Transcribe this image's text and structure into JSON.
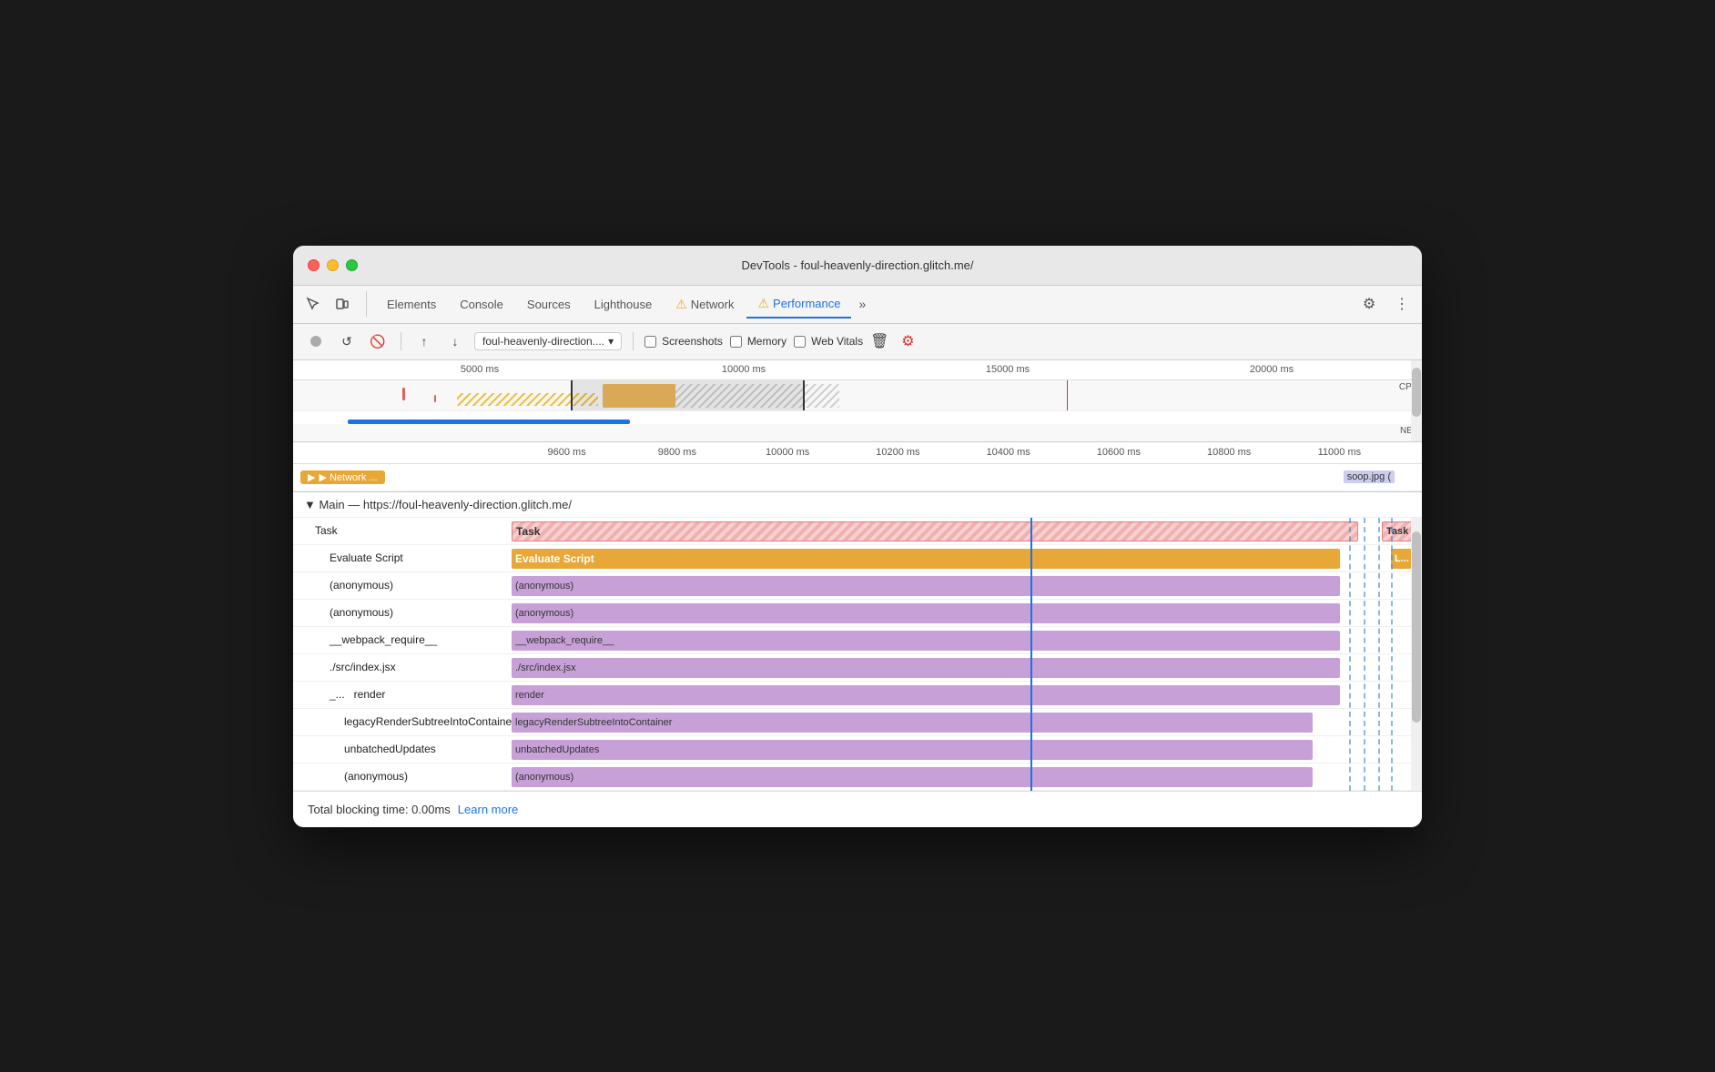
{
  "window": {
    "title": "DevTools - foul-heavenly-direction.glitch.me/"
  },
  "tabs": {
    "items": [
      {
        "label": "Elements",
        "active": false
      },
      {
        "label": "Console",
        "active": false
      },
      {
        "label": "Sources",
        "active": false
      },
      {
        "label": "Lighthouse",
        "active": false
      },
      {
        "label": "Network",
        "active": false,
        "warning": true
      },
      {
        "label": "Performance",
        "active": true,
        "warning": true
      }
    ],
    "more_label": "»"
  },
  "toolbar": {
    "url": "foul-heavenly-direction....",
    "screenshots_label": "Screenshots",
    "memory_label": "Memory",
    "web_vitals_label": "Web Vitals"
  },
  "timeline": {
    "overview_labels": [
      "5000 ms",
      "10000 ms",
      "15000 ms",
      "20000 ms"
    ],
    "zoomed_labels": [
      "9600 ms",
      "9800 ms",
      "10000 ms",
      "10200 ms",
      "10400 ms",
      "10600 ms",
      "10800 ms",
      "11000 ms"
    ],
    "cpu_label": "CPU",
    "net_label": "NET"
  },
  "network_row": {
    "label": "▶ Network ...",
    "soop_label": "soop.jpg ("
  },
  "main_section": {
    "title": "▼ Main — https://foul-heavenly-direction.glitch.me/"
  },
  "flame_rows": [
    {
      "label": "Task",
      "indent": 0,
      "type": "task",
      "width_pct": 96,
      "left_pct": 0,
      "tail_label": "Task"
    },
    {
      "label": "Evaluate Script",
      "indent": 1,
      "type": "eval",
      "width_pct": 94,
      "left_pct": 0,
      "tail_label": "L..."
    },
    {
      "label": "(anonymous)",
      "indent": 2,
      "type": "purple",
      "width_pct": 90,
      "left_pct": 0
    },
    {
      "label": "(anonymous)",
      "indent": 2,
      "type": "purple",
      "width_pct": 90,
      "left_pct": 0
    },
    {
      "label": "__webpack_require__",
      "indent": 2,
      "type": "purple",
      "width_pct": 90,
      "left_pct": 0
    },
    {
      "label": "./src/index.jsx",
      "indent": 2,
      "type": "purple",
      "width_pct": 90,
      "left_pct": 0
    },
    {
      "label": "_...   render",
      "indent": 2,
      "type": "purple",
      "width_pct": 90,
      "left_pct": 0
    },
    {
      "label": "legacyRenderSubtreeIntoContainer",
      "indent": 3,
      "type": "purple",
      "width_pct": 87,
      "left_pct": 0
    },
    {
      "label": "unbatchedUpdates",
      "indent": 3,
      "type": "purple",
      "width_pct": 87,
      "left_pct": 0
    },
    {
      "label": "(anonymous)",
      "indent": 3,
      "type": "purple",
      "width_pct": 87,
      "left_pct": 0
    }
  ],
  "status_bar": {
    "tbt_label": "Total blocking time: 0.00ms",
    "learn_more": "Learn more"
  }
}
